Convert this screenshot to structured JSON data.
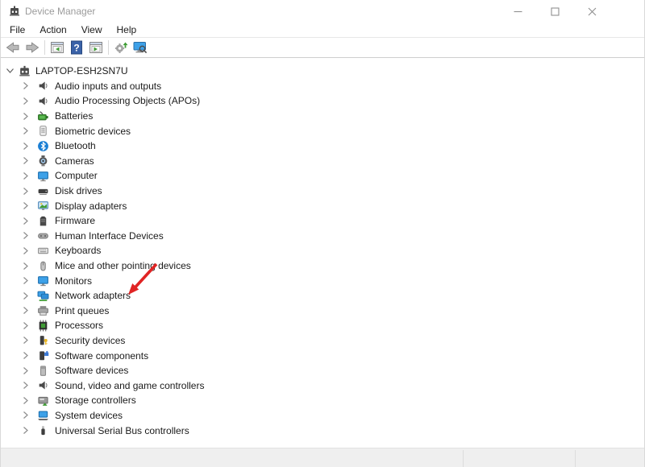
{
  "window": {
    "title": "Device Manager",
    "controls": {
      "minimize": "minimize",
      "maximize": "maximize",
      "close": "close"
    }
  },
  "menu": {
    "items": [
      "File",
      "Action",
      "View",
      "Help"
    ]
  },
  "toolbar": {
    "buttons": [
      {
        "id": "back",
        "icon": "back-arrow-icon"
      },
      {
        "id": "forward",
        "icon": "forward-arrow-icon"
      },
      {
        "id": "sep1",
        "icon": "separator"
      },
      {
        "id": "show-console-tree",
        "icon": "console-tree-icon"
      },
      {
        "id": "help",
        "icon": "help-icon"
      },
      {
        "id": "properties",
        "icon": "properties-window-icon"
      },
      {
        "id": "sep2",
        "icon": "separator"
      },
      {
        "id": "update-driver",
        "icon": "gear-update-icon"
      },
      {
        "id": "scan-hardware-changes",
        "icon": "scan-computer-icon"
      }
    ]
  },
  "tree": {
    "root": {
      "id": "laptop-esh2sn7u",
      "label": "LAPTOP-ESH2SN7U",
      "icon": "computer-root-icon",
      "expanded": true
    },
    "items": [
      {
        "id": "audio-inputs-and-outputs",
        "label": "Audio inputs and outputs",
        "icon": "speaker-icon"
      },
      {
        "id": "audio-processing-objects",
        "label": "Audio Processing Objects (APOs)",
        "icon": "speaker-icon"
      },
      {
        "id": "batteries",
        "label": "Batteries",
        "icon": "battery-icon"
      },
      {
        "id": "biometric-devices",
        "label": "Biometric devices",
        "icon": "fingerprint-icon"
      },
      {
        "id": "bluetooth",
        "label": "Bluetooth",
        "icon": "bluetooth-icon"
      },
      {
        "id": "cameras",
        "label": "Cameras",
        "icon": "camera-icon"
      },
      {
        "id": "computer",
        "label": "Computer",
        "icon": "monitor-icon"
      },
      {
        "id": "disk-drives",
        "label": "Disk drives",
        "icon": "disk-icon"
      },
      {
        "id": "display-adapters",
        "label": "Display adapters",
        "icon": "display-adapter-icon"
      },
      {
        "id": "firmware",
        "label": "Firmware",
        "icon": "firmware-icon"
      },
      {
        "id": "human-interface-devices",
        "label": "Human Interface Devices",
        "icon": "hid-icon"
      },
      {
        "id": "keyboards",
        "label": "Keyboards",
        "icon": "keyboard-icon"
      },
      {
        "id": "mice-and-other-pointing-devices",
        "label": "Mice and other pointing devices",
        "icon": "mouse-icon"
      },
      {
        "id": "monitors",
        "label": "Monitors",
        "icon": "monitor-icon"
      },
      {
        "id": "network-adapters",
        "label": "Network adapters",
        "icon": "network-icon"
      },
      {
        "id": "print-queues",
        "label": "Print queues",
        "icon": "printer-icon"
      },
      {
        "id": "processors",
        "label": "Processors",
        "icon": "processor-icon"
      },
      {
        "id": "security-devices",
        "label": "Security devices",
        "icon": "security-key-icon"
      },
      {
        "id": "software-components",
        "label": "Software components",
        "icon": "software-component-icon"
      },
      {
        "id": "software-devices",
        "label": "Software devices",
        "icon": "software-device-icon"
      },
      {
        "id": "sound-video-and-game-controllers",
        "label": "Sound, video and game controllers",
        "icon": "speaker-icon"
      },
      {
        "id": "storage-controllers",
        "label": "Storage controllers",
        "icon": "storage-icon"
      },
      {
        "id": "system-devices",
        "label": "System devices",
        "icon": "system-laptop-icon"
      },
      {
        "id": "universal-serial-bus-controllers",
        "label": "Universal Serial Bus controllers",
        "icon": "usb-icon"
      }
    ]
  },
  "annotation": {
    "type": "red-arrow",
    "points_to": "Network adapters",
    "color": "#e02424"
  },
  "colors": {
    "accent_blue": "#3da1e8",
    "green": "#3f9c35",
    "help_blue": "#3a62a8",
    "title_gray": "#9b9b9b",
    "text": "#1a1a1a"
  }
}
